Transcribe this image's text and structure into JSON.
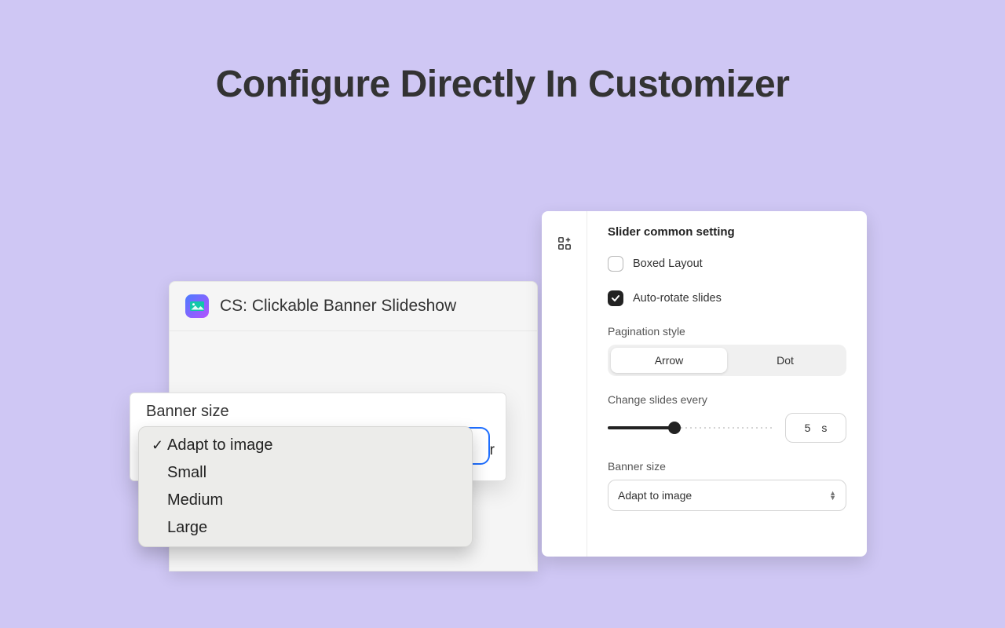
{
  "headline": "Configure Directly In Customizer",
  "leftCard": {
    "title": "CS: Clickable Banner Slideshow"
  },
  "bannerSize": {
    "label": "Banner size",
    "trailingChar": "r",
    "options": [
      "Adapt to image",
      "Small",
      "Medium",
      "Large"
    ],
    "selectedIndex": 0
  },
  "panel": {
    "title": "Slider common setting",
    "boxedLayout": {
      "label": "Boxed Layout",
      "checked": false
    },
    "autoRotate": {
      "label": "Auto-rotate slides",
      "checked": true
    },
    "pagination": {
      "label": "Pagination style",
      "options": [
        "Arrow",
        "Dot"
      ],
      "activeIndex": 0
    },
    "changeEvery": {
      "label": "Change slides every",
      "value": "5",
      "unit": "s"
    },
    "bannerSize": {
      "label": "Banner size",
      "value": "Adapt to image"
    }
  }
}
